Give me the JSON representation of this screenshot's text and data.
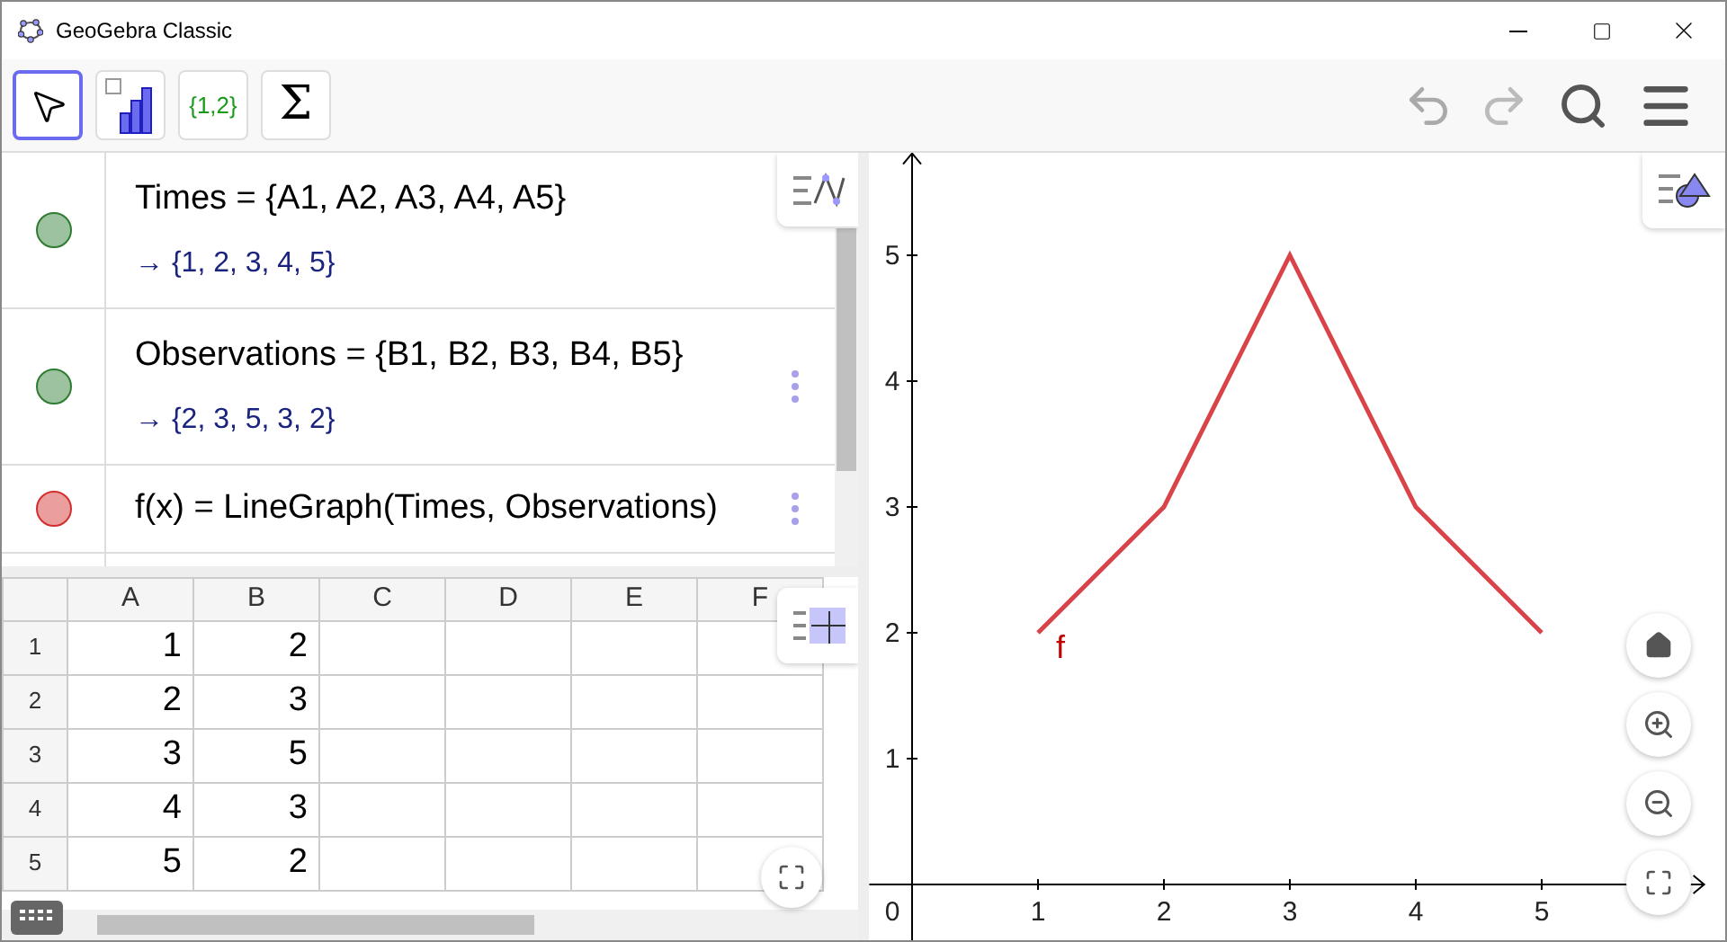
{
  "window": {
    "title": "GeoGebra Classic"
  },
  "toolbar": {
    "tools": [
      {
        "kind": "move",
        "selected": true
      },
      {
        "kind": "chart",
        "selected": false
      },
      {
        "kind": "list",
        "label": "{1,2}",
        "selected": false
      },
      {
        "kind": "sum",
        "label": "Σ",
        "selected": false
      }
    ]
  },
  "algebra": {
    "items": [
      {
        "kind": "list",
        "definition": "Times = {A1, A2, A3, A4, A5}",
        "value": "→ {1, 2, 3, 4, 5}",
        "color": "#2e7d32",
        "menu": false
      },
      {
        "kind": "list",
        "definition": "Observations = {B1, B2, B3, B4, B5}",
        "value": "→ {2, 3, 5, 3, 2}",
        "color": "#2e7d32",
        "menu": true
      },
      {
        "kind": "function",
        "definition": "f(x)  =  LineGraph(Times, Observations)",
        "color": "#d32f2f",
        "menu": true
      }
    ]
  },
  "spreadsheet": {
    "columns": [
      "A",
      "B",
      "C",
      "D",
      "E",
      "F"
    ],
    "rows": [
      {
        "header": "1",
        "cells": [
          "1",
          "2"
        ]
      },
      {
        "header": "2",
        "cells": [
          "2",
          "3"
        ]
      },
      {
        "header": "3",
        "cells": [
          "3",
          "5"
        ]
      },
      {
        "header": "4",
        "cells": [
          "4",
          "3"
        ]
      },
      {
        "header": "5",
        "cells": [
          "5",
          "2"
        ]
      }
    ]
  },
  "graphics": {
    "origin_label": "0",
    "chart_data": {
      "type": "line",
      "x": [
        1,
        2,
        3,
        4,
        5
      ],
      "series": [
        {
          "name": "f",
          "color": "#d9434a",
          "values": [
            2,
            3,
            5,
            3,
            2
          ]
        }
      ],
      "xlim": [
        -0.34,
        6.29
      ],
      "ylim": [
        -0.47,
        5.81
      ],
      "xticks": [
        1,
        2,
        3,
        4,
        5
      ],
      "yticks": [
        1,
        2,
        3,
        4,
        5
      ]
    }
  }
}
